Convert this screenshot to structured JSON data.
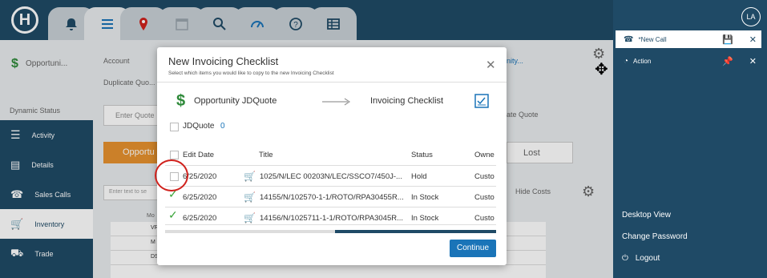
{
  "app": {
    "logo": "H",
    "user_initials": "LA"
  },
  "tabs": [
    {
      "icon": "bell-icon"
    },
    {
      "icon": "menu-icon"
    },
    {
      "icon": "map-pin-icon"
    },
    {
      "icon": "calendar-icon"
    },
    {
      "icon": "search-icon"
    },
    {
      "icon": "dashboard-icon"
    },
    {
      "icon": "help-icon"
    },
    {
      "icon": "table-icon"
    }
  ],
  "right_panel": {
    "new_call_label": "*New Call",
    "action_label": "Action",
    "links": [
      "Desktop View",
      "Change Password",
      "Logout"
    ]
  },
  "background": {
    "breadcrumb": "Opportuni...",
    "account_label": "Account",
    "duplicate_label": "Duplicate Quo...",
    "dynamic_status": "Dynamic Status",
    "enter_quote": "Enter Quote",
    "opportunity_btn": "Opportu",
    "lost_btn": "Lost",
    "hide_costs": "Hide Costs",
    "filter_placeholder": "Enter text to se",
    "right_link": "nity...",
    "right_quote": "ate Quote",
    "col_mo": "Mo",
    "rows": [
      "VR",
      "M",
      "DS"
    ]
  },
  "sidebar": {
    "items": [
      {
        "label": "Activity",
        "icon": "list-icon"
      },
      {
        "label": "Details",
        "icon": "details-icon"
      },
      {
        "label": "Sales Calls",
        "icon": "phone-icon"
      },
      {
        "label": "Inventory",
        "icon": "cart-icon"
      },
      {
        "label": "Trade",
        "icon": "tractor-icon"
      }
    ]
  },
  "modal": {
    "title": "New Invoicing Checklist",
    "subtitle": "Select which items you would like to copy to the new Invoicing Checklist",
    "source": "Opportunity JDQuote",
    "target": "Invoicing Checklist",
    "group_label": "JDQuote",
    "group_count": "0",
    "columns": [
      "Edit Date",
      "Title",
      "Status",
      "Owne"
    ],
    "rows": [
      {
        "checked": false,
        "date": "6/25/2020",
        "title": "1025/N/LEC 00203N/LEC/SSCO7/450J-...",
        "status": "Hold",
        "owner": "Custo"
      },
      {
        "checked": true,
        "date": "6/25/2020",
        "title": "14155/N/102570-1-1/ROTO/RPA30455R...",
        "status": "In Stock",
        "owner": "Custo"
      },
      {
        "checked": true,
        "date": "6/25/2020",
        "title": "14156/N/1025711-1-1/ROTO/RPA3045R...",
        "status": "In Stock",
        "owner": "Custo"
      }
    ],
    "continue_label": "Continue"
  },
  "colors": {
    "navy": "#1f4a66",
    "accent": "#1a74b8",
    "orange": "#e8922f",
    "annotation": "#d0211c",
    "check": "#3aa53a"
  }
}
